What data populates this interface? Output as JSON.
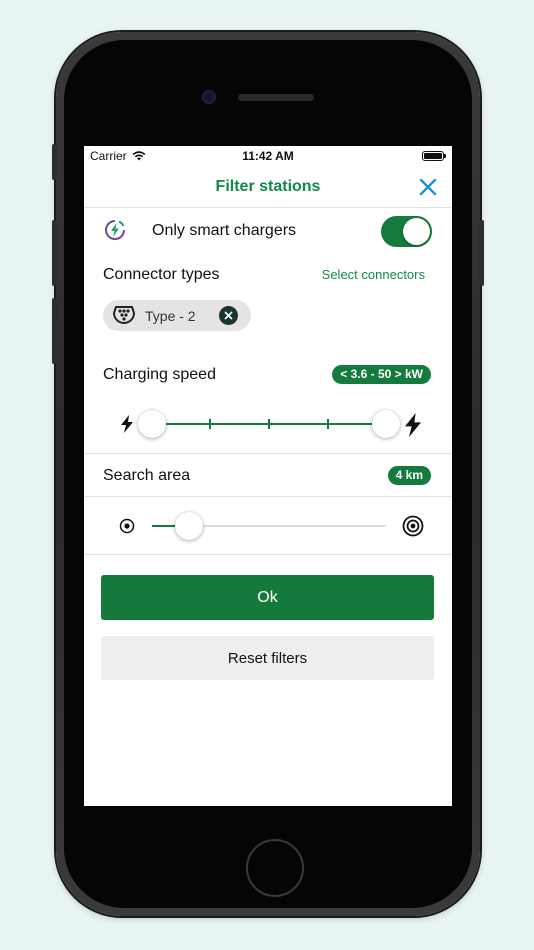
{
  "status_bar": {
    "carrier": "Carrier",
    "time": "11:42 AM",
    "icons": [
      "wifi-icon",
      "battery-icon"
    ]
  },
  "header": {
    "title": "Filter stations",
    "close_icon": "close-icon"
  },
  "smart_chargers": {
    "label": "Only smart chargers",
    "icon": "smart-charger-icon",
    "enabled": true
  },
  "connectors": {
    "title": "Connector types",
    "select_link": "Select connectors",
    "selected": [
      {
        "label": "Type - 2",
        "icon": "type2-connector-icon"
      }
    ]
  },
  "charging_speed": {
    "title": "Charging speed",
    "badge": "< 3.6 - 50 > kW",
    "slider_min_fraction": 0.0,
    "slider_max_fraction": 1.0,
    "steps": 4,
    "min_icon": "bolt-small-icon",
    "max_icon": "bolt-large-icon"
  },
  "search_area": {
    "title": "Search area",
    "badge": "4 km",
    "slider_fraction": 0.16,
    "min_icon": "target-small-icon",
    "max_icon": "target-large-icon"
  },
  "buttons": {
    "ok": "Ok",
    "reset": "Reset filters"
  },
  "colors": {
    "accent_green": "#147a3d",
    "title_green": "#0e8a4a",
    "close_blue": "#1e90d6",
    "smart_icon_purple": "#6a4c9c"
  }
}
